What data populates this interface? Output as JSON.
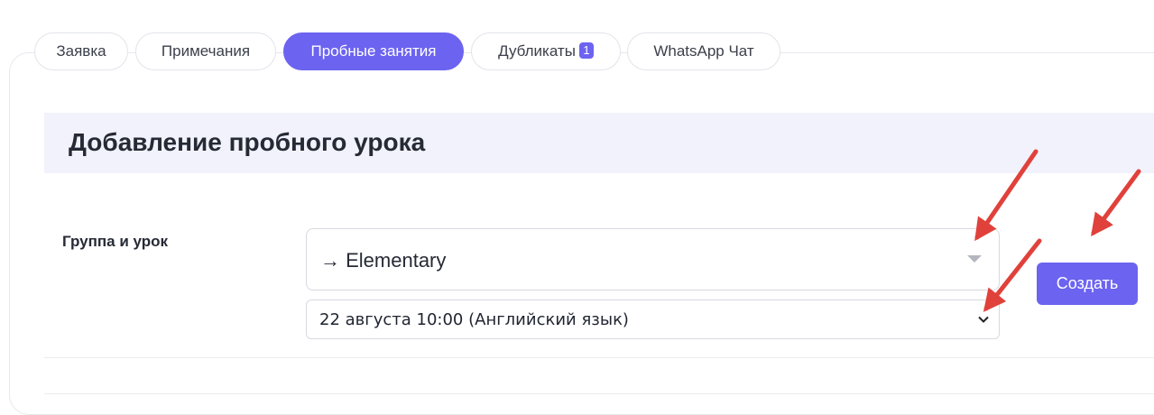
{
  "tabs": [
    {
      "label": "Заявка"
    },
    {
      "label": "Примечания"
    },
    {
      "label": "Пробные занятия",
      "active": true
    },
    {
      "label": "Дубликаты",
      "badge": "1"
    },
    {
      "label": "WhatsApp Чат"
    }
  ],
  "section": {
    "title": "Добавление пробного урока"
  },
  "form": {
    "group_lesson_label": "Группа и урок",
    "group_select_value": "→ Elementary",
    "lesson_select_value": "22 августа 10:00 (Английский язык)",
    "create_button": "Создать"
  },
  "colors": {
    "accent": "#6c63f0",
    "annotation_arrow": "#e0413b",
    "section_header_bg": "#f1f2fb"
  },
  "icons": {
    "group_select_caret": "caret-down-icon",
    "lesson_select_chevron": "chevron-down-icon"
  }
}
